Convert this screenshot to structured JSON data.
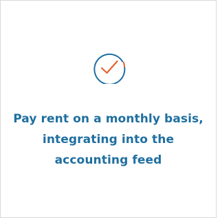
{
  "feature": {
    "icon": "check-circle-icon",
    "text": "Pay rent on a monthly basis, integrating into the accounting feed"
  },
  "colors": {
    "circle": "#1f6fa0",
    "check": "#e4612e",
    "text": "#1f6fa0",
    "border": "#d9d9d9"
  }
}
